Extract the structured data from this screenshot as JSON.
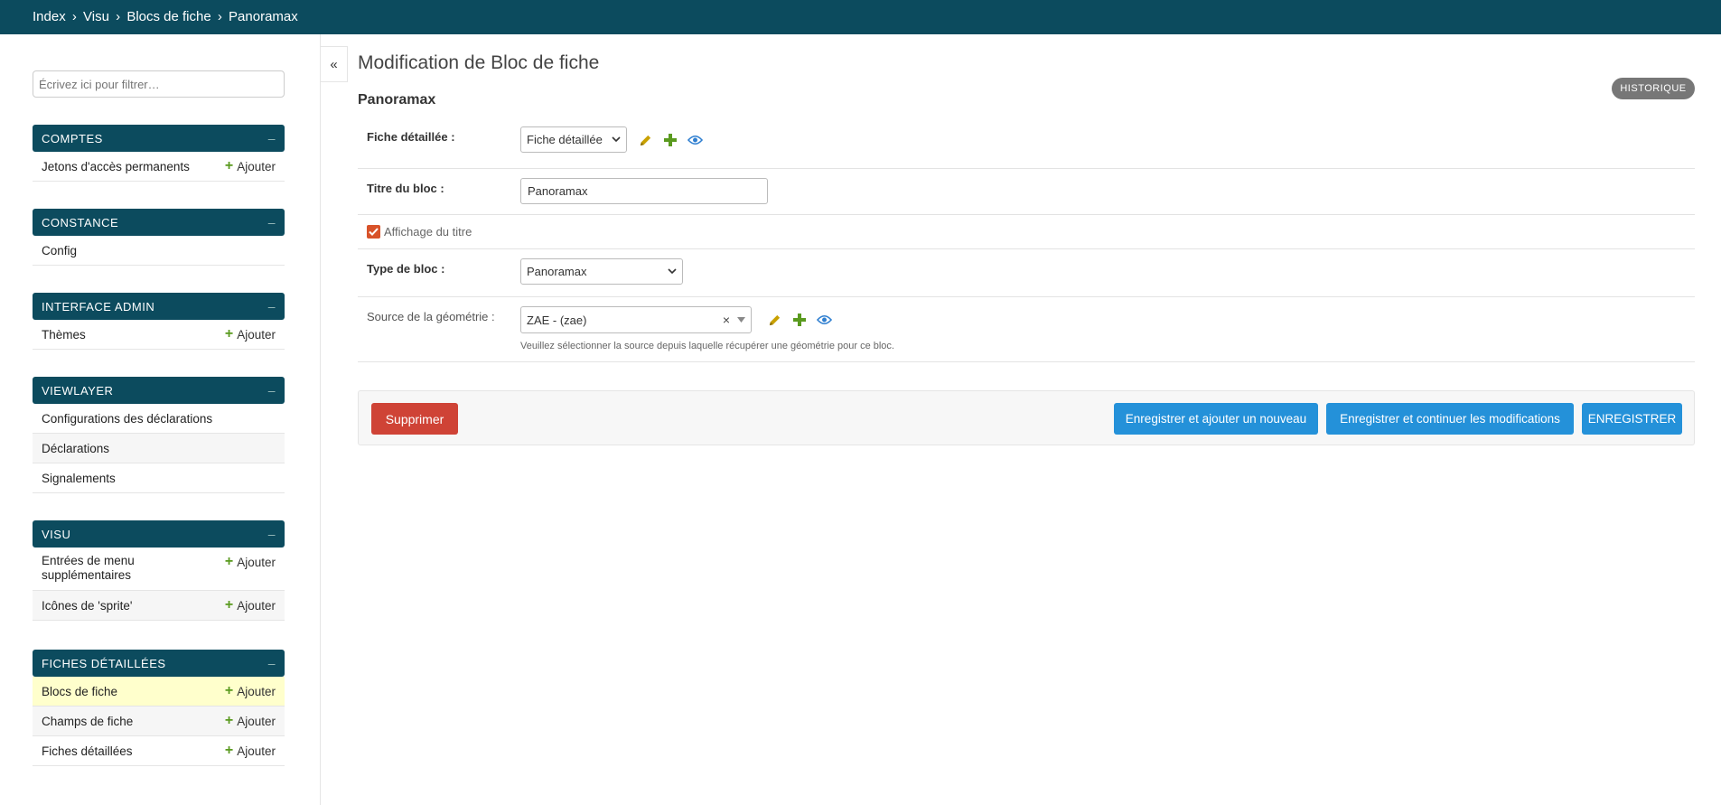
{
  "breadcrumbs": {
    "items": [
      "Index",
      "Visu",
      "Blocs de fiche",
      "Panoramax"
    ],
    "separator": "›"
  },
  "sidebar": {
    "filter_placeholder": "Écrivez ici pour filtrer…",
    "add_label": "Ajouter",
    "collapse_symbol": "–",
    "modules": [
      {
        "title": "COMPTES",
        "items": [
          {
            "label": "Jetons d'accès permanents",
            "add": true
          }
        ]
      },
      {
        "title": "CONSTANCE",
        "items": [
          {
            "label": "Config",
            "add": false
          }
        ]
      },
      {
        "title": "INTERFACE ADMIN",
        "items": [
          {
            "label": "Thèmes",
            "add": true
          }
        ]
      },
      {
        "title": "VIEWLAYER",
        "items": [
          {
            "label": "Configurations des déclarations",
            "add": false
          },
          {
            "label": "Déclarations",
            "add": false
          },
          {
            "label": "Signalements",
            "add": false
          }
        ]
      },
      {
        "title": "VISU",
        "items": [
          {
            "label": "Entrées de menu supplémentaires",
            "add": true
          },
          {
            "label": "Icônes de 'sprite'",
            "add": true
          }
        ]
      },
      {
        "title": "FICHES DÉTAILLÉES",
        "items": [
          {
            "label": "Blocs de fiche",
            "add": true,
            "selected": true
          },
          {
            "label": "Champs de fiche",
            "add": true
          },
          {
            "label": "Fiches détaillées",
            "add": true
          }
        ]
      }
    ]
  },
  "toggle_label": "«",
  "page": {
    "title": "Modification de Bloc de fiche",
    "object_title": "Panoramax",
    "history_label": "HISTORIQUE"
  },
  "form": {
    "fiche": {
      "label": "Fiche détaillée :",
      "value": "Fiche détaillée"
    },
    "titre": {
      "label": "Titre du bloc :",
      "value": "Panoramax"
    },
    "affichage": {
      "label": "Affichage du titre",
      "checked": true
    },
    "type": {
      "label": "Type de bloc :",
      "value": "Panoramax"
    },
    "source": {
      "label": "Source de la géométrie :",
      "value": "ZAE - (zae)",
      "clear": "×",
      "help": "Veuillez sélectionner la source depuis laquelle récupérer une géométrie pour ce bloc."
    }
  },
  "actions": {
    "delete": "Supprimer",
    "save_add": "Enregistrer et ajouter un nouveau",
    "save_continue": "Enregistrer et continuer les modifications",
    "save": "ENREGISTRER"
  },
  "colors": {
    "header": "#0c4b5e",
    "primary_button": "#2491d9",
    "delete_button": "#cf4336",
    "selected_row": "#ffffcc",
    "add_icon": "#5a9a1f",
    "edit_icon": "#c9a100",
    "view_icon": "#2f7fd0"
  }
}
